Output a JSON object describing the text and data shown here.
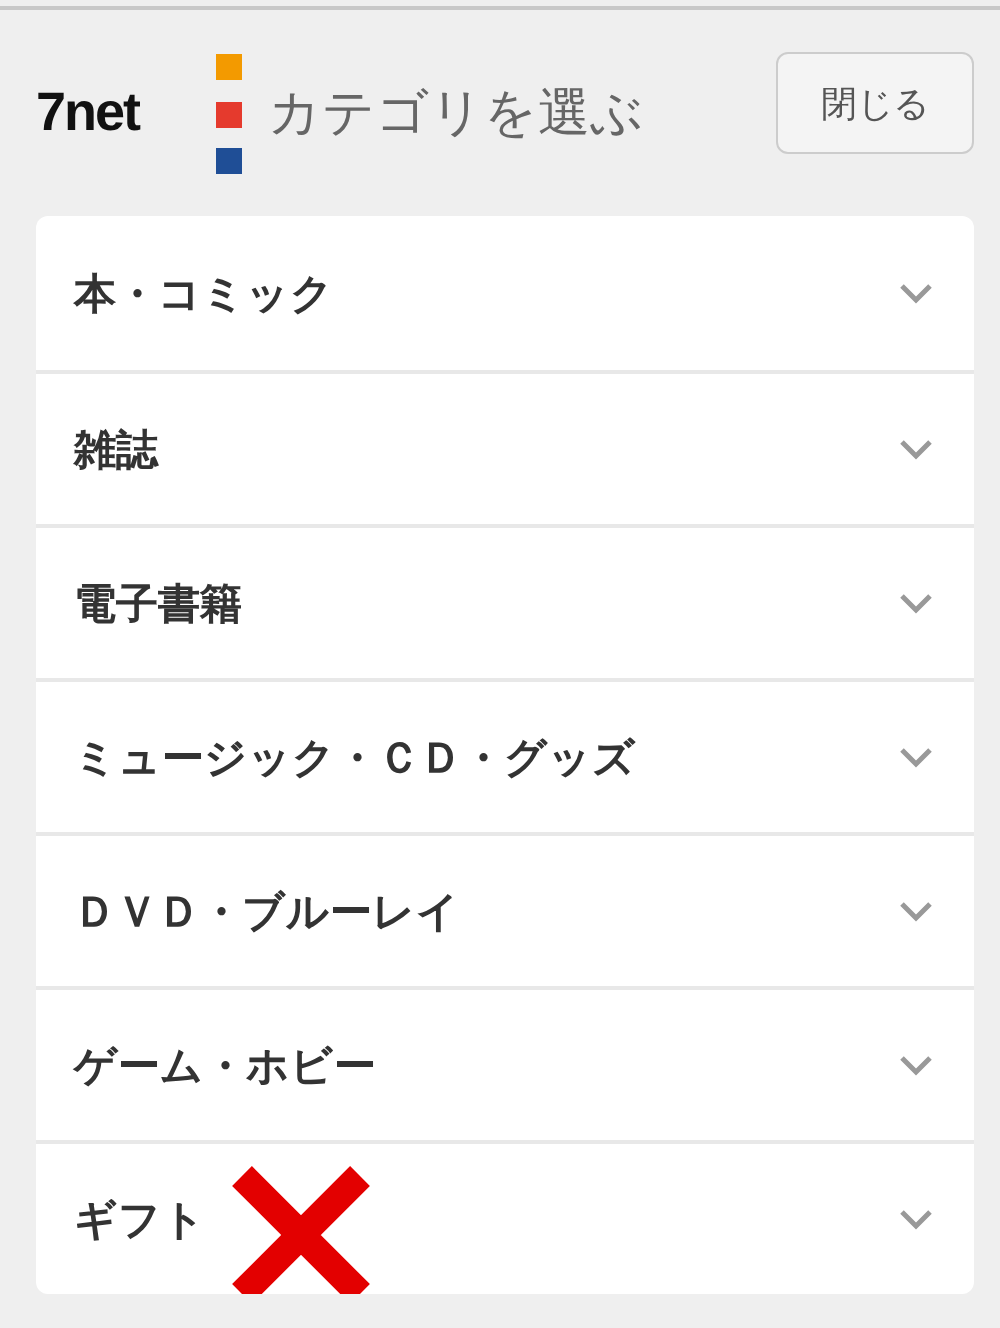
{
  "header": {
    "logo": "7net",
    "title": "カテゴリを選ぶ",
    "close_button": "閉じる"
  },
  "categories": [
    {
      "label": "本・コミック",
      "crossed": false
    },
    {
      "label": "雑誌",
      "crossed": false
    },
    {
      "label": "電子書籍",
      "crossed": false
    },
    {
      "label": "ミュージック・ＣＤ・グッズ",
      "crossed": false
    },
    {
      "label": "ＤＶＤ・ブルーレイ",
      "crossed": false
    },
    {
      "label": "ゲーム・ホビー",
      "crossed": false
    },
    {
      "label": "ギフト",
      "crossed": true
    }
  ]
}
